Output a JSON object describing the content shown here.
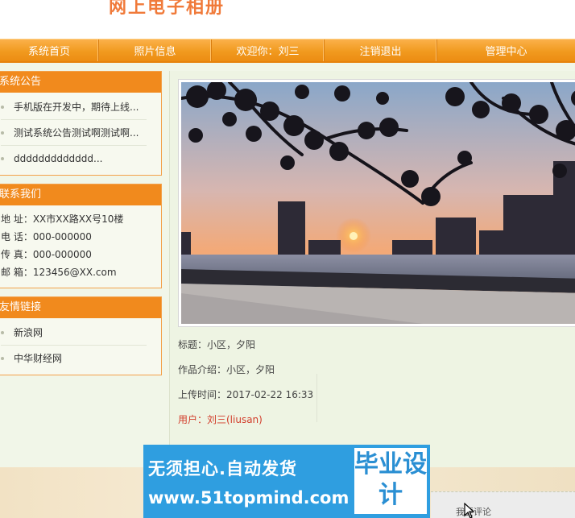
{
  "header": {
    "site_title": "网上电子相册"
  },
  "nav": {
    "items": [
      {
        "label": "系统首页"
      },
      {
        "label": "照片信息"
      },
      {
        "label": "欢迎你：刘三"
      },
      {
        "label": "注销退出"
      },
      {
        "label": "管理中心"
      }
    ]
  },
  "sidebar": {
    "announcements": {
      "title": "系统公告",
      "items": [
        {
          "label": "手机版在开发中，期待上线..."
        },
        {
          "label": "测试系统公告测试啊测试啊..."
        },
        {
          "label": "ddddddddddddd..."
        }
      ]
    },
    "contact": {
      "title": "联系我们",
      "address": "地 址：XX市XX路XX号10楼",
      "phone": "电 话：000-000000",
      "fax": "传 真：000-000000",
      "email": "邮 箱：123456@XX.com"
    },
    "links": {
      "title": "友情链接",
      "items": [
        {
          "label": "新浪网"
        },
        {
          "label": "中华财经网"
        }
      ]
    }
  },
  "photo": {
    "title_line": "标题：小区，夕阳",
    "intro_line": "作品介绍：小区，夕阳",
    "upload_line": "上传时间：2017-02-22 16:33",
    "user_line": "用户：刘三(liusan)"
  },
  "comment": {
    "label": "我要评论"
  },
  "ad": {
    "line1": "无须担心.自动发货",
    "line2": "www.51topmind.com",
    "badge": "毕业设计"
  },
  "colors": {
    "nav": "#f19a1f",
    "box_header": "#f18a1d",
    "ad": "#2f9ee0",
    "user_text": "#d23c2a"
  }
}
